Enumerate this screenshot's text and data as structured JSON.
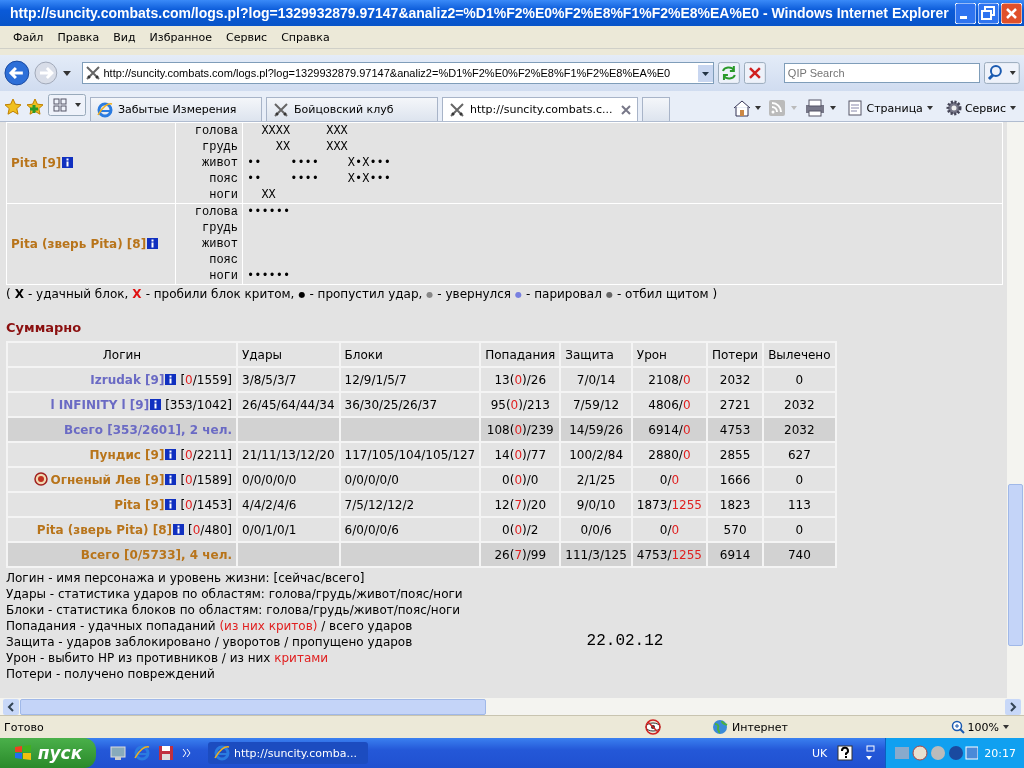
{
  "window": {
    "title": "http://suncity.combats.com/logs.pl?log=1329932879.97147&analiz2=%D1%F2%E0%F2%E8%F1%F2%E8%EA%E0 - Windows Internet Explorer"
  },
  "menu": [
    "Файл",
    "Правка",
    "Вид",
    "Избранное",
    "Сервис",
    "Справка"
  ],
  "address_bar": {
    "value": "http://suncity.combats.com/logs.pl?log=1329932879.97147&analiz2=%D1%F2%E0%F2%E8%F1%F2%E8%EA%E0",
    "search_placeholder": "QIP Search"
  },
  "tabs": [
    {
      "label": "Забытые Измерения",
      "selected": false,
      "kind": "ie"
    },
    {
      "label": "Бойцовский клуб",
      "selected": false,
      "kind": "swords"
    },
    {
      "label": "http://suncity.combats.c...",
      "selected": true,
      "kind": "swords"
    }
  ],
  "toolbar": [
    {
      "label": "Страница",
      "kind": "page"
    },
    {
      "label": "Сервис",
      "kind": "gear"
    }
  ],
  "battle_rows": [
    {
      "name": "Pita",
      "rank": "[9]",
      "color": "#b8741a",
      "parts": [
        {
          "label": "голова",
          "marks": "  XXXX     XXX"
        },
        {
          "label": "грудь",
          "marks": "    XX     XXX"
        },
        {
          "label": "живот",
          "marks": "••    ••••    X•X•••"
        },
        {
          "label": "пояс",
          "marks": "••    ••••    X•X•••"
        },
        {
          "label": "ноги",
          "marks": "  XX"
        }
      ]
    },
    {
      "name": "Pita (зверь Pita)",
      "rank": "[8]",
      "color": "#b8741a",
      "parts": [
        {
          "label": "голова",
          "marks": "••••••"
        },
        {
          "label": "грудь"
        },
        {
          "label": "живот"
        },
        {
          "label": "пояс"
        },
        {
          "label": "ноги",
          "marks": "••••••"
        }
      ]
    }
  ],
  "legend": {
    "open": "(",
    "close": ")",
    "items": [
      {
        "kind": "cross",
        "symbol": "X",
        "color": "#000000",
        "text": "- удачный блок,"
      },
      {
        "kind": "cross",
        "symbol": "X",
        "color": "#e01010",
        "text": "- пробили блок критом,"
      },
      {
        "kind": "dot",
        "symbol": "●",
        "color": "#000000",
        "text": "- пропустил удар,"
      },
      {
        "kind": "dot",
        "symbol": "●",
        "color": "#888888",
        "text": "- увернулся"
      },
      {
        "kind": "dot",
        "symbol": "●",
        "color": "#7880e0",
        "text": "- парировал"
      },
      {
        "kind": "dot",
        "symbol": "●",
        "color": "#666666",
        "text": "- отбил щитом"
      }
    ]
  },
  "summary": {
    "heading": "Суммарно",
    "columns": [
      "Логин",
      "Удары",
      "Блоки",
      "Попадания",
      "Защита",
      "Урон",
      "Потери",
      "Вылечено"
    ],
    "rows": [
      {
        "kind": "player",
        "color": "#6a6ac4",
        "emblem": false,
        "name": "Izrudak",
        "rank": "[9]",
        "hp": [
          {
            "text": "[",
            "highlight": false
          },
          {
            "text": "0",
            "highlight": true
          },
          {
            "text": "/1559]",
            "highlight": false
          }
        ],
        "strikes": "3/8/5/3/7",
        "blocks": "12/9/1/5/7",
        "hits": [
          {
            "text": "13(",
            "highlight": false
          },
          {
            "text": "0",
            "highlight": true
          },
          {
            "text": ")/26",
            "highlight": false
          }
        ],
        "defense": "7/0/14",
        "damage": [
          {
            "text": "2108/",
            "highlight": false
          },
          {
            "text": "0",
            "highlight": true
          }
        ],
        "losses": "2032",
        "healed": "0"
      },
      {
        "kind": "player",
        "color": "#6a6ac4",
        "emblem": false,
        "name": "l INFINITY l",
        "rank": "[9]",
        "hp": [
          {
            "text": "[353/1042]",
            "highlight": false
          }
        ],
        "strikes": "26/45/64/44/34",
        "blocks": "36/30/25/26/37",
        "hits": [
          {
            "text": "95(",
            "highlight": false
          },
          {
            "text": "0",
            "highlight": true
          },
          {
            "text": ")/213",
            "highlight": false
          }
        ],
        "defense": "7/59/12",
        "damage": [
          {
            "text": "4806/",
            "highlight": false
          },
          {
            "text": "0",
            "highlight": true
          }
        ],
        "losses": "2721",
        "healed": "2032"
      },
      {
        "kind": "total",
        "color": "#6a6ac4",
        "label": "Всего [353/2601], 2 чел.",
        "hits": [
          {
            "text": "108(",
            "highlight": false
          },
          {
            "text": "0",
            "highlight": true
          },
          {
            "text": ")/239",
            "highlight": false
          }
        ],
        "defense": "14/59/26",
        "damage": [
          {
            "text": "6914/",
            "highlight": false
          },
          {
            "text": "0",
            "highlight": true
          }
        ],
        "losses": "4753",
        "healed": "2032"
      },
      {
        "kind": "player",
        "color": "#b8741a",
        "emblem": false,
        "name": "Пундис",
        "rank": "[9]",
        "hp": [
          {
            "text": "[",
            "highlight": false
          },
          {
            "text": "0",
            "highlight": true
          },
          {
            "text": "/2211]",
            "highlight": false
          }
        ],
        "strikes": "21/11/13/12/20",
        "blocks": "117/105/104/105/127",
        "hits": [
          {
            "text": "14(",
            "highlight": false
          },
          {
            "text": "0",
            "highlight": true
          },
          {
            "text": ")/77",
            "highlight": false
          }
        ],
        "defense": "100/2/84",
        "damage": [
          {
            "text": "2880/",
            "highlight": false
          },
          {
            "text": "0",
            "highlight": true
          }
        ],
        "losses": "2855",
        "healed": "627"
      },
      {
        "kind": "player",
        "color": "#b8741a",
        "emblem": true,
        "name": "Огненый Лев",
        "rank": "[9]",
        "hp": [
          {
            "text": "[",
            "highlight": false
          },
          {
            "text": "0",
            "highlight": true
          },
          {
            "text": "/1589]",
            "highlight": false
          }
        ],
        "strikes": "0/0/0/0/0",
        "blocks": "0/0/0/0/0",
        "hits": [
          {
            "text": "0(",
            "highlight": false
          },
          {
            "text": "0",
            "highlight": true
          },
          {
            "text": ")/0",
            "highlight": false
          }
        ],
        "defense": "2/1/25",
        "damage": [
          {
            "text": "0/",
            "highlight": false
          },
          {
            "text": "0",
            "highlight": true
          }
        ],
        "losses": "1666",
        "healed": "0"
      },
      {
        "kind": "player",
        "color": "#b8741a",
        "emblem": false,
        "name": "Pita",
        "rank": "[9]",
        "hp": [
          {
            "text": "[",
            "highlight": false
          },
          {
            "text": "0",
            "highlight": true
          },
          {
            "text": "/1453]",
            "highlight": false
          }
        ],
        "strikes": "4/4/2/4/6",
        "blocks": "7/5/12/12/2",
        "hits": [
          {
            "text": "12(",
            "highlight": false
          },
          {
            "text": "7",
            "highlight": true
          },
          {
            "text": ")/20",
            "highlight": false
          }
        ],
        "defense": "9/0/10",
        "damage": [
          {
            "text": "1873/",
            "highlight": false
          },
          {
            "text": "1255",
            "highlight": true
          }
        ],
        "losses": "1823",
        "healed": "113"
      },
      {
        "kind": "player",
        "color": "#b8741a",
        "emblem": false,
        "name": "Pita (зверь Pita)",
        "rank": "[8]",
        "hp": [
          {
            "text": "[",
            "highlight": false
          },
          {
            "text": "0",
            "highlight": true
          },
          {
            "text": "/480]",
            "highlight": false
          }
        ],
        "strikes": "0/0/1/0/1",
        "blocks": "6/0/0/0/6",
        "hits": [
          {
            "text": "0(",
            "highlight": false
          },
          {
            "text": "0",
            "highlight": true
          },
          {
            "text": ")/2",
            "highlight": false
          }
        ],
        "defense": "0/0/6",
        "damage": [
          {
            "text": "0/",
            "highlight": false
          },
          {
            "text": "0",
            "highlight": true
          }
        ],
        "losses": "570",
        "healed": "0"
      },
      {
        "kind": "total",
        "color": "#b8741a",
        "label": "Всего [0/5733], 4 чел.",
        "hits": [
          {
            "text": "26(",
            "highlight": false
          },
          {
            "text": "7",
            "highlight": true
          },
          {
            "text": ")/99",
            "highlight": false
          }
        ],
        "defense": "111/3/125",
        "damage": [
          {
            "text": "4753/",
            "highlight": false
          },
          {
            "text": "1255",
            "highlight": true
          }
        ],
        "losses": "6914",
        "healed": "740"
      }
    ]
  },
  "notes": [
    [
      {
        "text": "Логин - имя персонажа и уровень жизни: [сейчас/всего]",
        "highlight": false
      }
    ],
    [
      {
        "text": "Удары - статистика ударов по областям: голова/грудь/живот/пояс/ноги",
        "highlight": false
      }
    ],
    [
      {
        "text": "Блоки - статистика блоков по областям: голова/грудь/живот/пояс/ноги",
        "highlight": false
      }
    ],
    [
      {
        "text": "Попадания - удачных попаданий ",
        "highlight": false
      },
      {
        "text": "(из них критов)",
        "highlight": true
      },
      {
        "text": " / всего ударов",
        "highlight": false
      }
    ],
    [
      {
        "text": "Защита - ударов заблокировано / уворотов / пропущено ударов",
        "highlight": false
      }
    ],
    [
      {
        "text": "Урон - выбито HP из противников / из них ",
        "highlight": false
      },
      {
        "text": "критами",
        "highlight": true
      }
    ],
    [
      {
        "text": "Потери - получено повреждений",
        "highlight": false
      }
    ]
  ],
  "date": "22.02.12",
  "status_bar": {
    "text": "Готово",
    "zone": "Интернет",
    "zoom": "100%"
  },
  "taskbar": {
    "start": "пуск",
    "task": "http://suncity.comba...",
    "language": "UK",
    "clock": "20:17"
  }
}
